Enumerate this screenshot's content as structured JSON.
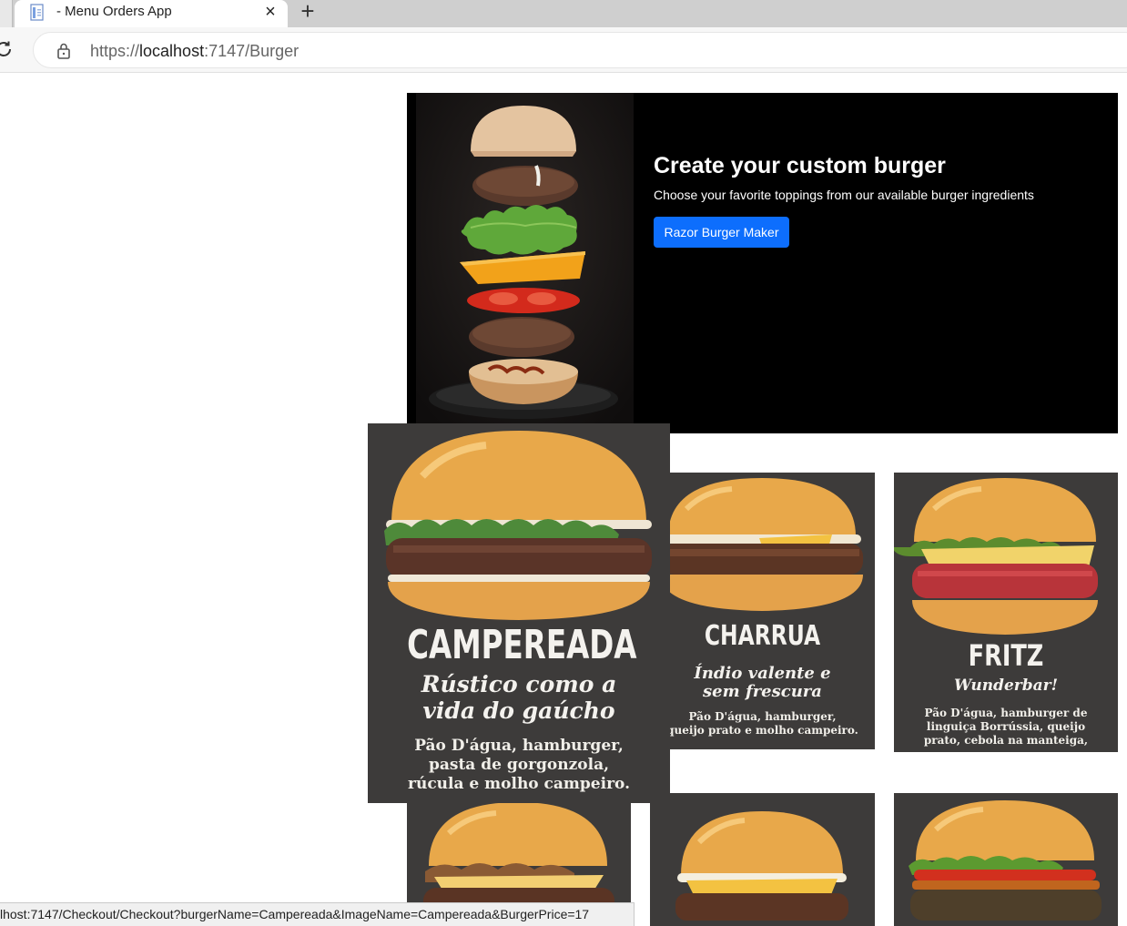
{
  "browser": {
    "tab_title": "- Menu Orders App",
    "close_glyph": "×",
    "new_tab_glyph": "+",
    "url_scheme": "https://",
    "url_host": "localhost",
    "url_rest": ":7147/Burger",
    "status_url": "lhost:7147/Checkout/Checkout?burgerName=Campereada&ImageName=Campereada&BurgerPrice=17"
  },
  "hero": {
    "title": "Create your custom burger",
    "subtitle": "Choose your favorite toppings from our available burger ingredients",
    "button_label": "Razor Burger Maker"
  },
  "burgers": [
    {
      "name": "CAMPEREADA",
      "tagline_line1": "Rústico como a",
      "tagline_line2": "vida do gaúcho",
      "desc_line1": "Pão D'água, hamburger,",
      "desc_line2": "pasta de gorgonzola,",
      "desc_line3": "rúcula e molho campeiro."
    },
    {
      "name": "CHARRUA",
      "tagline_line1": "Índio valente e",
      "tagline_line2": "sem frescura",
      "desc_line1": "Pão D'água, hamburger,",
      "desc_line2": "queijo prato e molho campeiro."
    },
    {
      "name": "FRITZ",
      "tagline_line1": "Wunderbar!",
      "desc_line1": "Pão D'água, hamburger de",
      "desc_line2": "linguiça Borrússia, queijo",
      "desc_line3": "prato, cebola na manteiga,"
    }
  ],
  "colors": {
    "tab_strip": "#cfcfcf",
    "hero_background": "#000000",
    "button": "#0d6efd",
    "card_background": "#3d3b3a"
  },
  "icons": {
    "tab": "page-favicon-icon",
    "close": "close-icon",
    "new_tab": "plus-icon",
    "reload": "reload-icon",
    "lock": "lock-icon"
  }
}
